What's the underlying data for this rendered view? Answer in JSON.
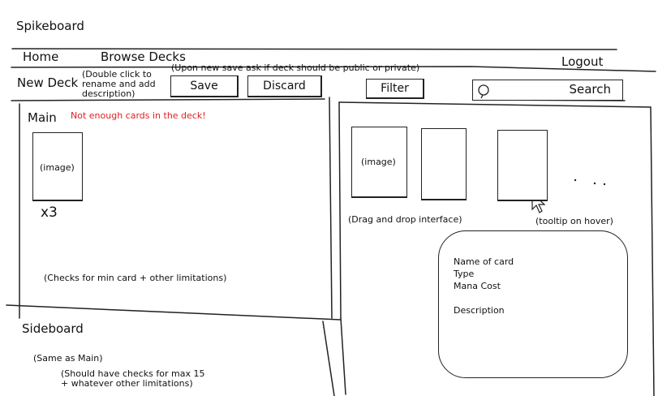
{
  "app": {
    "title": "Spikeboard"
  },
  "nav": {
    "home": "Home",
    "browse_decks": "Browse Decks",
    "logout": "Logout"
  },
  "toolbar": {
    "page_title": "New Deck",
    "rename_hint": "(Double click to rename and add description)",
    "save_note": "(Upon new save ask if deck should be public or private)",
    "save_label": "Save",
    "discard_label": "Discard",
    "filter_label": "Filter",
    "search_label": "Search",
    "search_icon": "magnifier-icon"
  },
  "main_panel": {
    "title": "Main",
    "warning": "Not enough cards in the deck!",
    "warning_color": "#e02020",
    "card_image_label": "(image)",
    "card_count": "x3",
    "checks_note": "(Checks for min card + other limitations)"
  },
  "sideboard": {
    "title": "Sideboard",
    "same_as_main": "(Same as Main)",
    "checks_note": "(Should have checks for max 15 + whatever other limitations)"
  },
  "browser_panel": {
    "card_image_label": "(image)",
    "drag_drop_note": "(Drag and drop interface)",
    "tooltip_note": "(tooltip on hover)",
    "tooltip": {
      "name_label": "Name of card",
      "type_label": "Type",
      "mana_cost_label": "Mana Cost",
      "description_label": "Description"
    }
  }
}
